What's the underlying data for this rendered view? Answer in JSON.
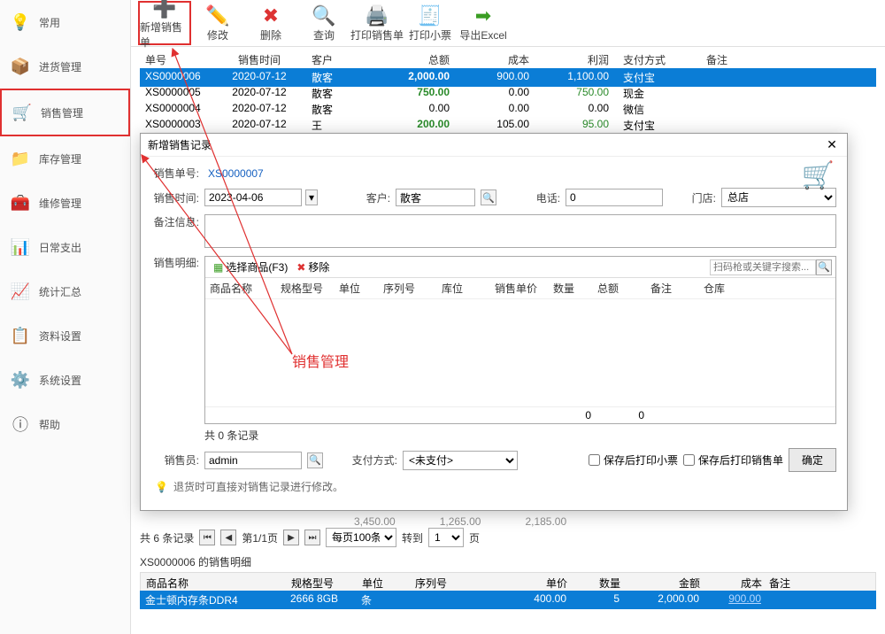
{
  "sidebar": {
    "items": [
      {
        "label": "常用",
        "icon": "💡"
      },
      {
        "label": "进货管理",
        "icon": "📦"
      },
      {
        "label": "销售管理",
        "icon": "🛒"
      },
      {
        "label": "库存管理",
        "icon": "📁"
      },
      {
        "label": "维修管理",
        "icon": "🧰"
      },
      {
        "label": "日常支出",
        "icon": "📊"
      },
      {
        "label": "统计汇总",
        "icon": "📈"
      },
      {
        "label": "资料设置",
        "icon": "📋"
      },
      {
        "label": "系统设置",
        "icon": "⚙️"
      },
      {
        "label": "帮助",
        "icon": "ⓘ"
      }
    ]
  },
  "toolbar": {
    "add": "新增销售单",
    "edit": "修改",
    "delete": "删除",
    "query": "查询",
    "print_order": "打印销售单",
    "print_receipt": "打印小票",
    "export": "导出Excel"
  },
  "grid": {
    "headers": {
      "order": "单号",
      "date": "销售时间",
      "cust": "客户",
      "amt": "总额",
      "cost": "成本",
      "profit": "利润",
      "pay": "支付方式",
      "note": "备注"
    },
    "rows": [
      {
        "order": "XS0000006",
        "date": "2020-07-12",
        "cust": "散客",
        "amt": "2,000.00",
        "cost": "900.00",
        "profit": "1,100.00",
        "pay": "支付宝"
      },
      {
        "order": "XS0000005",
        "date": "2020-07-12",
        "cust": "散客",
        "amt": "750.00",
        "cost": "0.00",
        "profit": "750.00",
        "pay": "现金"
      },
      {
        "order": "XS0000004",
        "date": "2020-07-12",
        "cust": "散客",
        "amt": "0.00",
        "cost": "0.00",
        "profit": "0.00",
        "pay": "微信"
      },
      {
        "order": "XS0000003",
        "date": "2020-07-12",
        "cust": "王",
        "amt": "200.00",
        "cost": "105.00",
        "profit": "95.00",
        "pay": "支付宝"
      }
    ]
  },
  "dialog": {
    "title": "新增销售记录",
    "order_no_label": "销售单号:",
    "order_no": "XS0000007",
    "date_label": "销售时间:",
    "date": "2023-04-06",
    "cust_label": "客户:",
    "cust": "散客",
    "phone_label": "电话:",
    "phone": "0",
    "store_label": "门店:",
    "store": "总店",
    "note_label": "备注信息:",
    "detail_label": "销售明细:",
    "select_goods": "选择商品(F3)",
    "remove": "移除",
    "scan_placeholder": "扫码枪或关键字搜索...",
    "det_headers": {
      "name": "商品名称",
      "spec": "规格型号",
      "unit": "单位",
      "serial": "序列号",
      "stock": "库位",
      "price": "销售单价",
      "qty": "数量",
      "total": "总额",
      "note": "备注",
      "wh": "仓库"
    },
    "det_foot_qty": "0",
    "det_foot_total": "0",
    "record_count": "共 0 条记录",
    "seller_label": "销售员:",
    "seller": "admin",
    "paymode_label": "支付方式:",
    "paymode": "<未支付>",
    "chk_receipt": "保存后打印小票",
    "chk_order": "保存后打印销售单",
    "ok": "确定",
    "tip": "退货时可直接对销售记录进行修改。"
  },
  "ghost": {
    "a": "3,450.00",
    "b": "1,265.00",
    "c": "2,185.00"
  },
  "pager": {
    "total": "共 6 条记录",
    "page": "第1/1页",
    "per": "每页100条",
    "goto_label": "转到",
    "goto": "1",
    "page_suffix": "页"
  },
  "detail_section": {
    "title": "XS0000006 的销售明细",
    "headers": {
      "name": "商品名称",
      "spec": "规格型号",
      "unit": "单位",
      "serial": "序列号",
      "price": "单价",
      "qty": "数量",
      "amt": "金额",
      "cost": "成本",
      "note": "备注"
    },
    "row": {
      "name": "金士顿内存条DDR4",
      "spec": "2666 8GB",
      "unit": "条",
      "serial": "",
      "price": "400.00",
      "qty": "5",
      "amt": "2,000.00",
      "cost": "900.00",
      "note": ""
    }
  },
  "annotation": {
    "label": "销售管理"
  }
}
